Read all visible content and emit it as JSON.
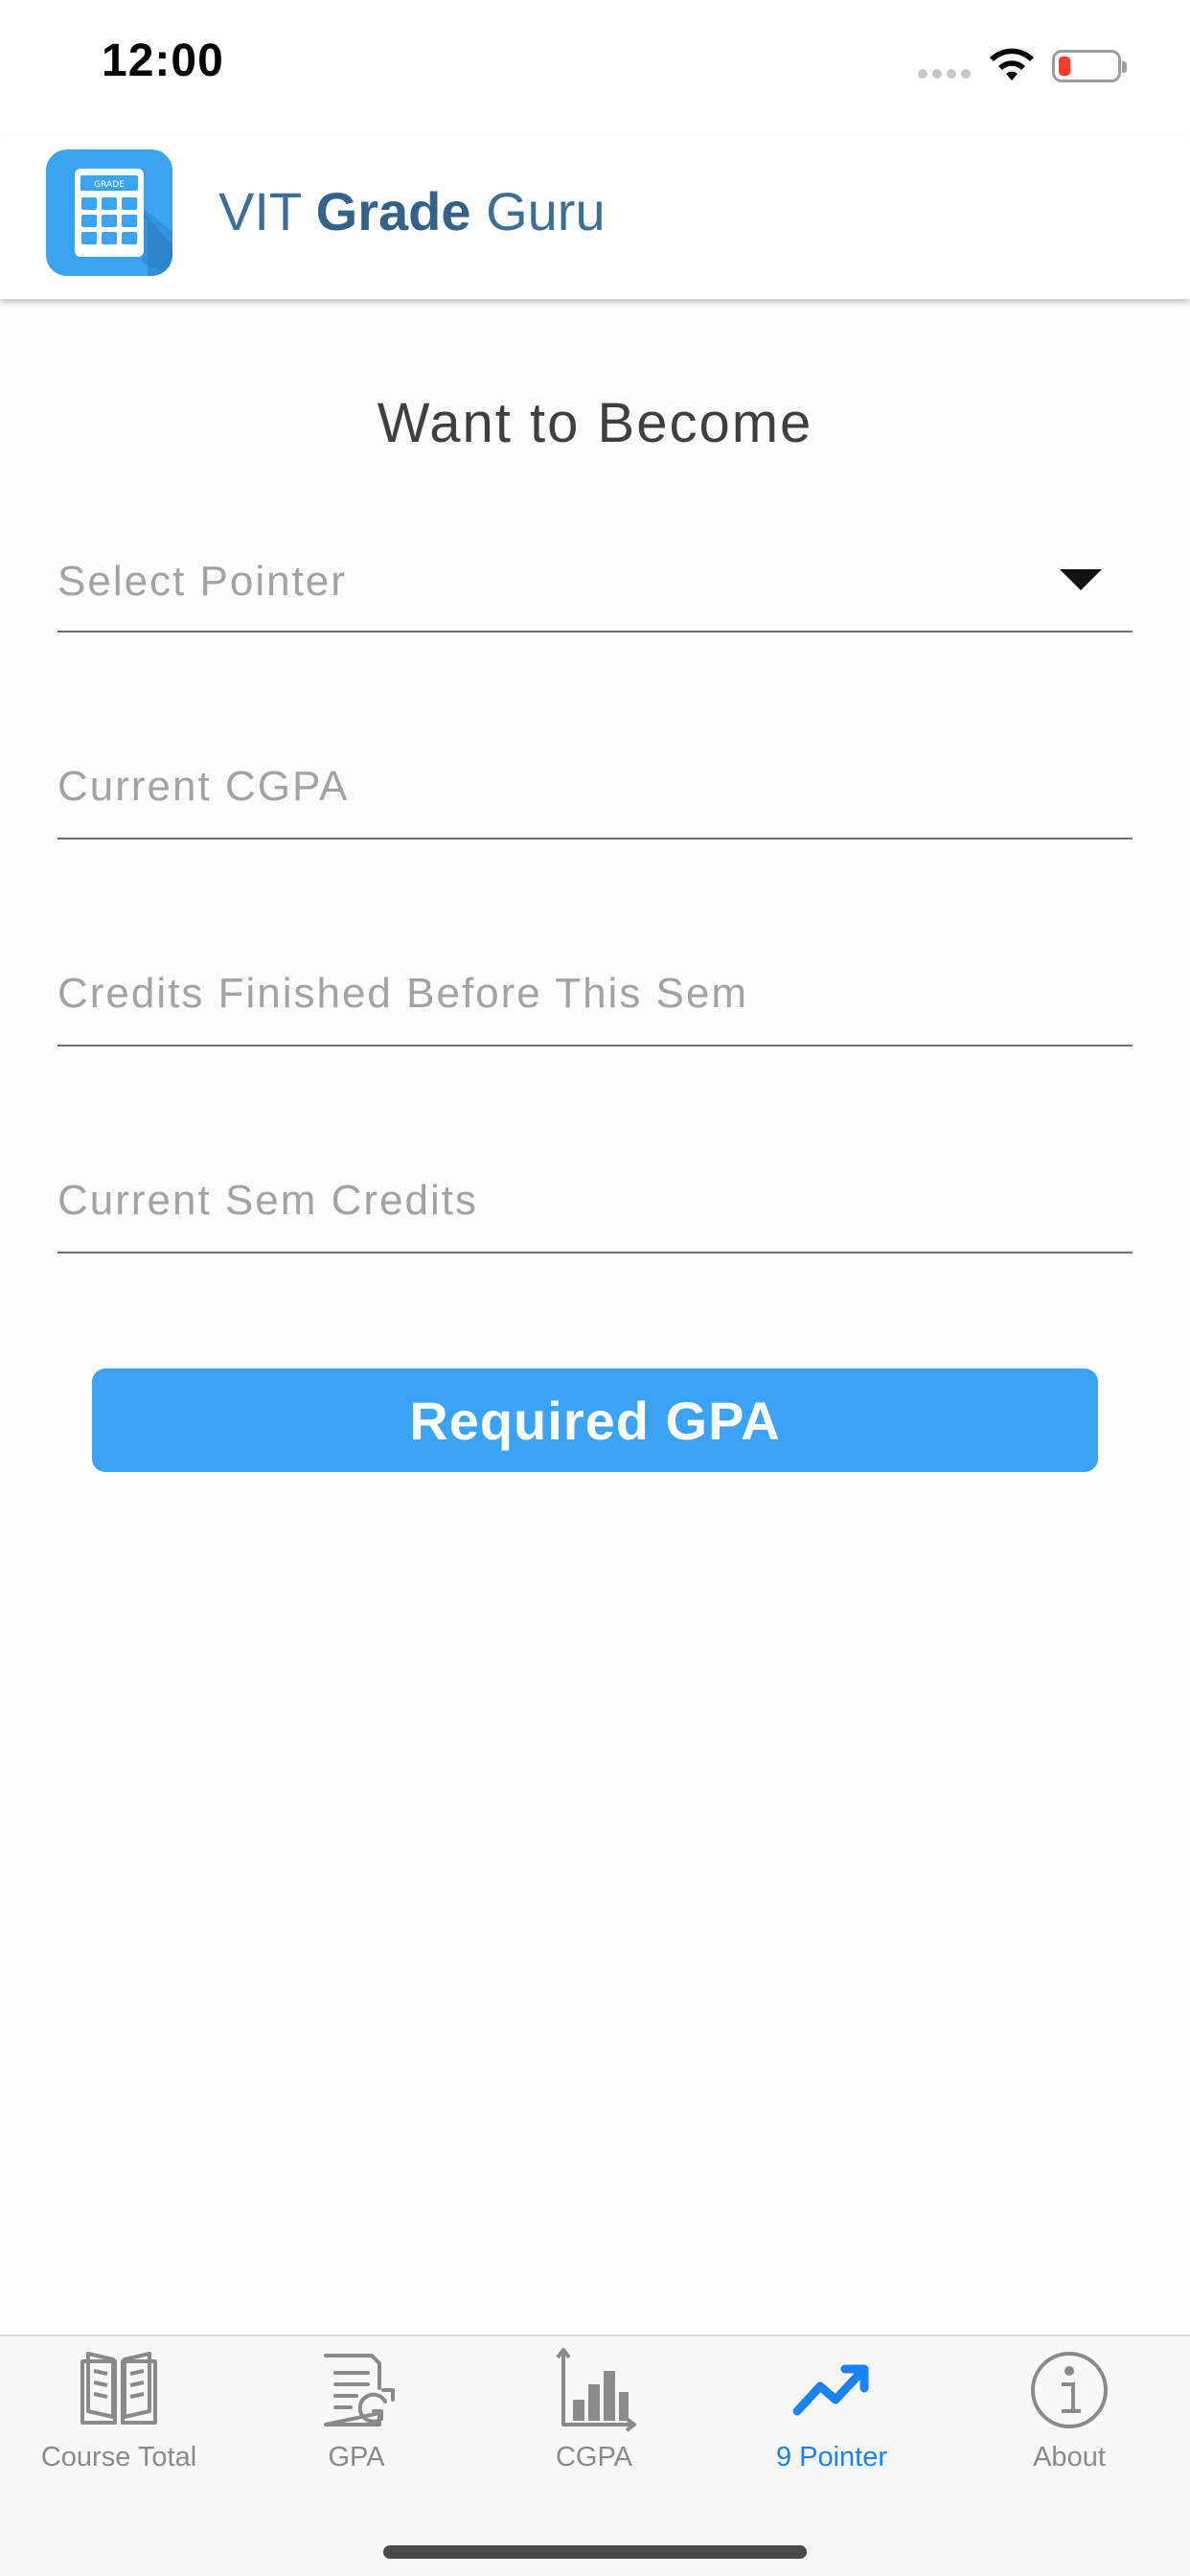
{
  "status_bar": {
    "time": "12:00"
  },
  "header": {
    "title_prefix": "VIT ",
    "title_bold": "Grade",
    "title_suffix": " Guru",
    "logo_text": "GRADE"
  },
  "main": {
    "heading": "Want to Become",
    "select_pointer": {
      "placeholder": "Select Pointer"
    },
    "current_cgpa": {
      "placeholder": "Current CGPA"
    },
    "credits_finished": {
      "placeholder": "Credits Finished Before This Sem"
    },
    "current_sem_credits": {
      "placeholder": "Current Sem Credits"
    },
    "submit_label": "Required GPA"
  },
  "tab_bar": {
    "tabs": [
      {
        "label": "Course Total",
        "icon": "book-icon"
      },
      {
        "label": "GPA",
        "icon": "gpa-document-icon"
      },
      {
        "label": "CGPA",
        "icon": "bar-chart-icon"
      },
      {
        "label": "9 Pointer",
        "icon": "trending-up-icon",
        "active": true
      },
      {
        "label": "About",
        "icon": "info-icon"
      }
    ]
  },
  "colors": {
    "accent": "#3aa3f5",
    "active_tab": "#1a82f7",
    "title": "#3d6f96"
  }
}
